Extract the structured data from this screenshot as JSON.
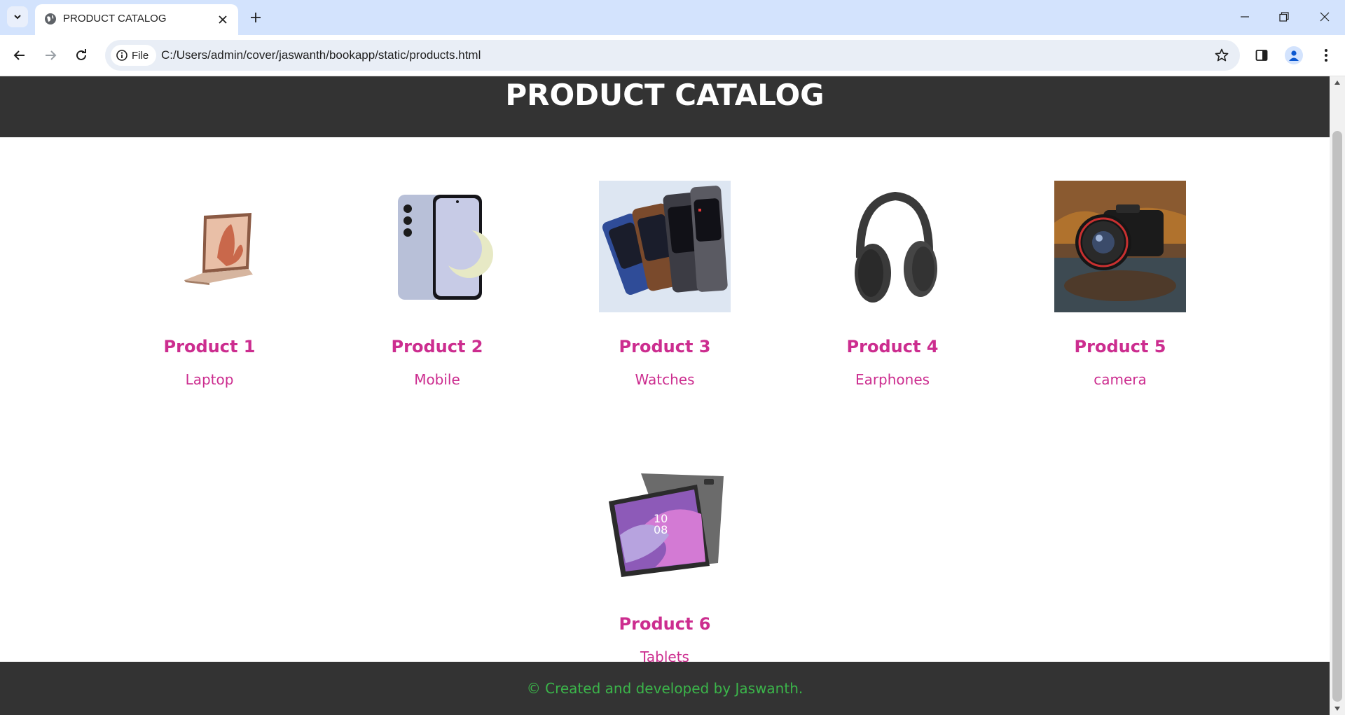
{
  "browser": {
    "tab_title": "PRODUCT CATALOG",
    "address_chip": "File",
    "url": "C:/Users/admin/cover/jaswanth/bookapp/static/products.html"
  },
  "page": {
    "title": "PRODUCT CATALOG",
    "products": [
      {
        "name": "Product 1",
        "description": "Laptop",
        "image_icon": "laptop-image"
      },
      {
        "name": "Product 2",
        "description": "Mobile",
        "image_icon": "mobile-image"
      },
      {
        "name": "Product 3",
        "description": "Watches",
        "image_icon": "watches-image"
      },
      {
        "name": "Product 4",
        "description": "Earphones",
        "image_icon": "earphones-image"
      },
      {
        "name": "Product 5",
        "description": "camera",
        "image_icon": "camera-image"
      },
      {
        "name": "Product 6",
        "description": "Tablets",
        "image_icon": "tablet-image"
      }
    ],
    "footer": "© Created and developed by Jaswanth."
  },
  "colors": {
    "header_bg": "#333333",
    "product_text": "#cc2d8f",
    "footer_text": "#3bb54a",
    "tabstrip_bg": "#d3e3fd"
  }
}
